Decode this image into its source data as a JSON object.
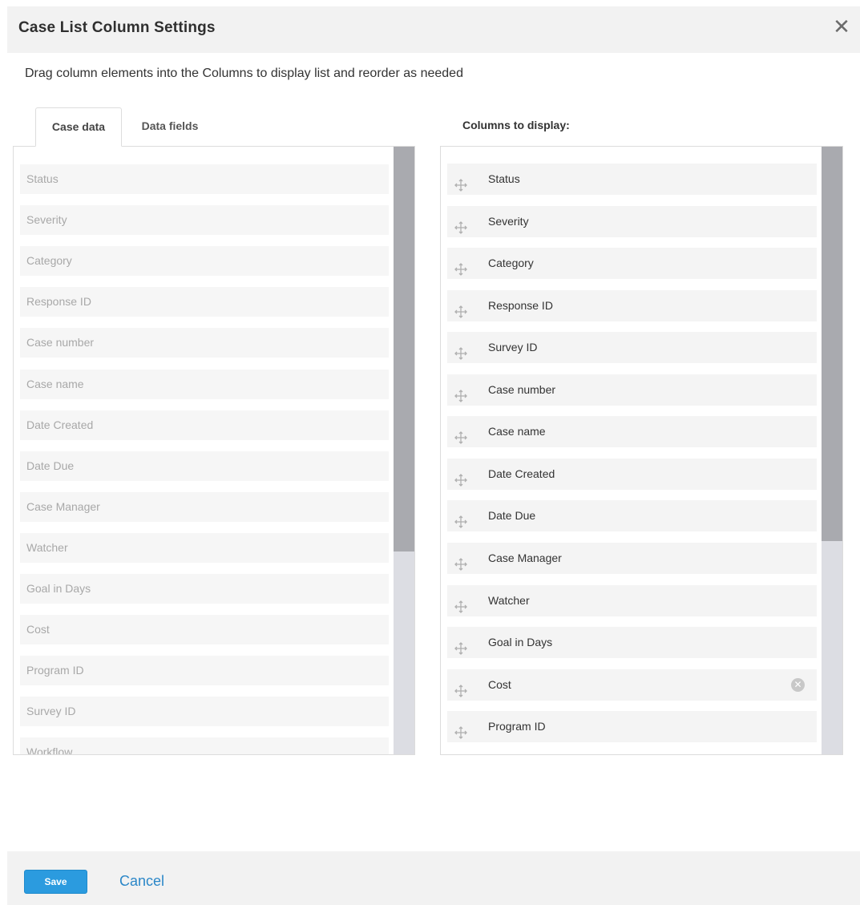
{
  "dialog": {
    "title": "Case List Column Settings",
    "instructions": "Drag column elements into the Columns to display list and reorder as needed"
  },
  "tabs": [
    {
      "label": "Case data",
      "active": true
    },
    {
      "label": "Data fields",
      "active": false
    }
  ],
  "available_columns": [
    "Status",
    "Severity",
    "Category",
    "Response ID",
    "Case number",
    "Case name",
    "Date Created",
    "Date Due",
    "Case Manager",
    "Watcher",
    "Goal in Days",
    "Cost",
    "Program ID",
    "Survey ID",
    "Workflow"
  ],
  "columns_heading": "Columns to display:",
  "selected_columns": [
    "Status",
    "Severity",
    "Category",
    "Response ID",
    "Survey ID",
    "Case number",
    "Case name",
    "Date Created",
    "Date Due",
    "Case Manager",
    "Watcher",
    "Goal in Days",
    "Cost",
    "Program ID"
  ],
  "hovered_selected_item": "Cost",
  "footer": {
    "save_label": "Save",
    "cancel_label": "Cancel"
  },
  "colors": {
    "primary_button": "#2b9bdf",
    "link": "#2b87c8",
    "header_bg": "#f2f2f2"
  },
  "icons": {
    "close": "close-icon",
    "drag": "move-icon",
    "remove": "remove-icon"
  }
}
